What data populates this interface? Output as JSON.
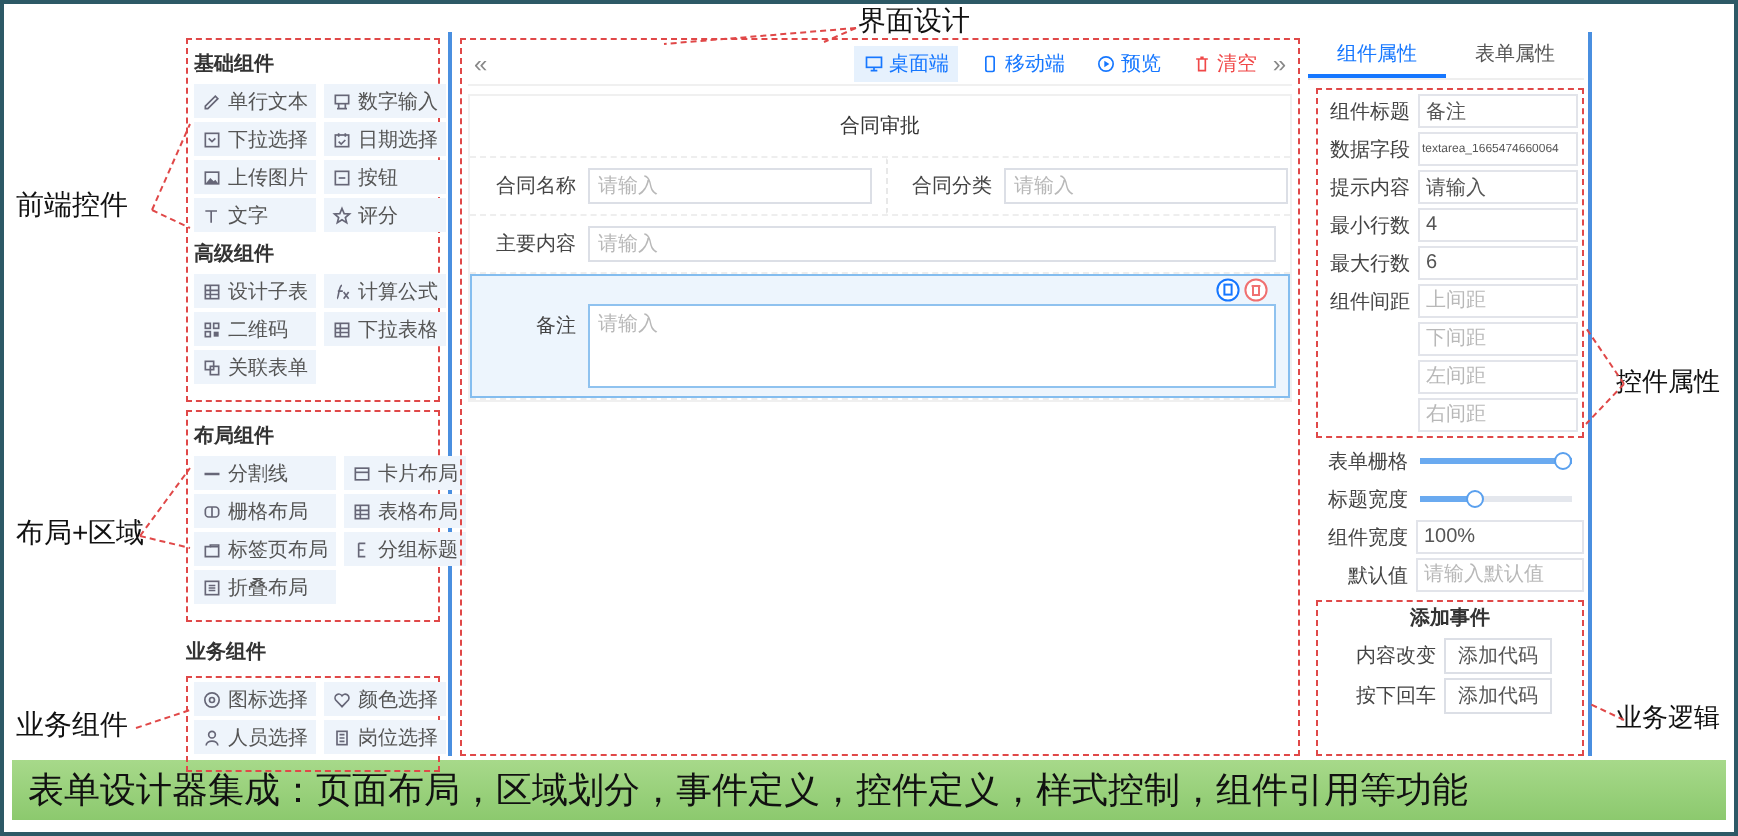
{
  "annotations": {
    "top": "界面设计",
    "left": [
      "前端控件",
      "布局+区域",
      "业务组件"
    ],
    "right": [
      "控件属性",
      "业务逻辑"
    ]
  },
  "palette": [
    {
      "title": "基础组件",
      "items": [
        "单行文本",
        "数字输入",
        "下拉选择",
        "日期选择",
        "上传图片",
        "按钮",
        "文字",
        "评分"
      ]
    },
    {
      "title": "高级组件",
      "items": [
        "设计子表",
        "计算公式",
        "二维码",
        "下拉表格",
        "关联表单"
      ]
    },
    {
      "title": "布局组件",
      "items": [
        "分割线",
        "卡片布局",
        "栅格布局",
        "表格布局",
        "标签页布局",
        "分组标题",
        "折叠布局"
      ]
    },
    {
      "title": "业务组件",
      "items": [
        "图标选择",
        "颜色选择",
        "人员选择",
        "岗位选择"
      ]
    }
  ],
  "designer": {
    "toolbar": {
      "left": "«",
      "right": "»",
      "buttons": [
        {
          "label": "桌面端",
          "kind": "monitor",
          "selected": true
        },
        {
          "label": "移动端",
          "kind": "phone",
          "selected": false
        },
        {
          "label": "预览",
          "kind": "preview",
          "selected": false
        },
        {
          "label": "清空",
          "kind": "clear",
          "selected": false
        }
      ]
    },
    "form": {
      "title": "合同审批",
      "rows": [
        {
          "fields": [
            {
              "label": "合同名称",
              "placeholder": "请输入",
              "kind": "input",
              "selected": false
            },
            {
              "label": "合同分类",
              "placeholder": "请输入",
              "kind": "input",
              "selected": false
            }
          ]
        },
        {
          "fields": [
            {
              "label": "主要内容",
              "placeholder": "请输入",
              "kind": "input",
              "selected": false
            }
          ]
        },
        {
          "fields": [
            {
              "label": "备注",
              "placeholder": "请输入",
              "kind": "textarea",
              "selected": true
            }
          ]
        }
      ]
    }
  },
  "properties": {
    "tabs": [
      {
        "label": "组件属性",
        "selected": true
      },
      {
        "label": "表单属性",
        "selected": false
      }
    ],
    "fields": [
      {
        "label": "组件标题",
        "kind": "input",
        "value": "备注"
      },
      {
        "label": "数据字段",
        "kind": "input",
        "value": "textarea_1665474660064"
      },
      {
        "label": "提示内容",
        "kind": "input",
        "value": "请输入"
      },
      {
        "label": "最小行数",
        "kind": "input",
        "value": "4"
      },
      {
        "label": "最大行数",
        "kind": "input",
        "value": "6"
      },
      {
        "label": "组件间距",
        "kind": "spacing",
        "placeholders": [
          "上间距",
          "下间距",
          "左间距",
          "右间距"
        ]
      },
      {
        "label": "表单栅格",
        "kind": "slider",
        "level": 1
      },
      {
        "label": "标题宽度",
        "kind": "slider",
        "level": 0.35
      },
      {
        "label": "组件宽度",
        "kind": "input",
        "value": "100%"
      },
      {
        "label": "默认值",
        "kind": "input",
        "placeholder": "请输入默认值"
      }
    ],
    "events": {
      "title": "添加事件",
      "items": [
        {
          "label": "内容改变",
          "button": "添加代码"
        },
        {
          "label": "按下回车",
          "button": "添加代码"
        }
      ]
    }
  },
  "banner": "表单设计器集成：页面布局，区域划分，事件定义，控件定义，样式控制，组件引用等功能"
}
